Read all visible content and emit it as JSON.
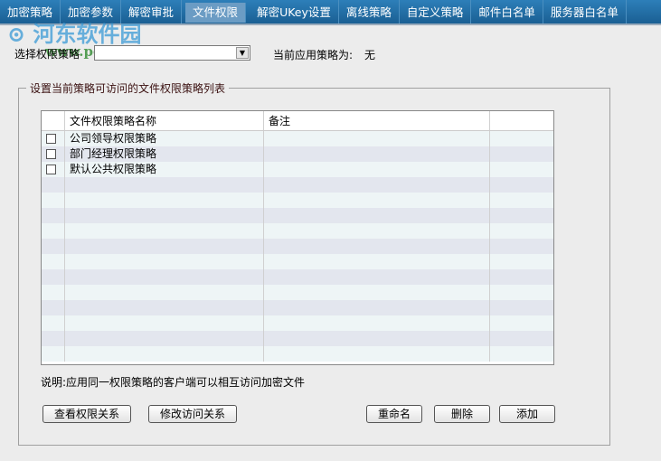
{
  "tabs": [
    "加密策略",
    "加密参数",
    "解密审批",
    "文件权限",
    "解密UKey设置",
    "离线策略",
    "自定义策略",
    "邮件白名单",
    "服务器白名单"
  ],
  "active_tab": 3,
  "watermark": {
    "name": "河东软件园",
    "url": "www.pc0359.cn"
  },
  "select_label": "选择权限策略",
  "select_value": "",
  "current_label": "当前应用策略为:",
  "current_value": "无",
  "group_title": "设置当前策略可访问的文件权限策略列表",
  "table": {
    "headers": [
      "",
      "文件权限策略名称",
      "备注",
      ""
    ],
    "rows": [
      {
        "name": "公司领导权限策略",
        "note": "",
        "checked": false
      },
      {
        "name": "部门经理权限策略",
        "note": "",
        "checked": false
      },
      {
        "name": "默认公共权限策略",
        "note": "",
        "checked": false
      }
    ]
  },
  "note": "说明:应用同一权限策略的客户端可以相互访问加密文件",
  "buttons": {
    "view": "查看权限关系",
    "modify": "修改访问关系",
    "rename": "重命名",
    "delete": "删除",
    "add": "添加"
  }
}
